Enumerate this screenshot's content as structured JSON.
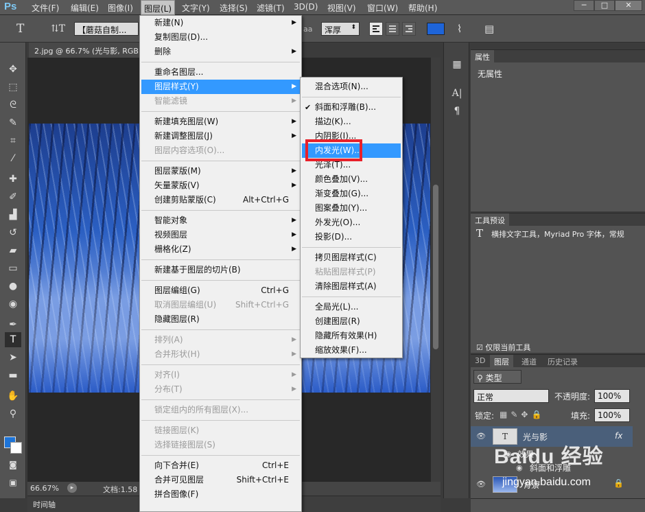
{
  "app": {
    "logo": "Ps"
  },
  "menubar": {
    "items": [
      "文件(F)",
      "编辑(E)",
      "图像(I)",
      "图层(L)",
      "文字(Y)",
      "选择(S)",
      "滤镜(T)",
      "3D(D)",
      "视图(V)",
      "窗口(W)",
      "帮助(H)"
    ],
    "active_index": 3
  },
  "window_controls": {
    "minimize": "─",
    "maximize": "□",
    "close": "✕"
  },
  "options_bar": {
    "tool_glyph": "T",
    "font_family": "【蘑菇自制...",
    "antialias": "浑厚",
    "aa_label": "aa",
    "text_color": "#1e64d8"
  },
  "document": {
    "tab_title": "2.jpg @ 66.7% (光与影, RGB",
    "zoom": "66.67%",
    "doc_info": "文档:1.58",
    "timeline_label": "时间轴"
  },
  "layer_menu": {
    "items": [
      {
        "label": "新建(N)",
        "submenu": true
      },
      {
        "label": "复制图层(D)..."
      },
      {
        "label": "删除",
        "submenu": true
      },
      {
        "sep": true
      },
      {
        "label": "重命名图层..."
      },
      {
        "label": "图层样式(Y)",
        "submenu": true,
        "highlight": true
      },
      {
        "label": "智能滤镜",
        "submenu": true,
        "disabled": true
      },
      {
        "sep": true
      },
      {
        "label": "新建填充图层(W)",
        "submenu": true
      },
      {
        "label": "新建调整图层(J)",
        "submenu": true
      },
      {
        "label": "图层内容选项(O)...",
        "disabled": true
      },
      {
        "sep": true
      },
      {
        "label": "图层蒙版(M)",
        "submenu": true
      },
      {
        "label": "矢量蒙版(V)",
        "submenu": true
      },
      {
        "label": "创建剪贴蒙版(C)",
        "shortcut": "Alt+Ctrl+G"
      },
      {
        "sep": true
      },
      {
        "label": "智能对象",
        "submenu": true
      },
      {
        "label": "视频图层",
        "submenu": true
      },
      {
        "label": "栅格化(Z)",
        "submenu": true
      },
      {
        "sep": true
      },
      {
        "label": "新建基于图层的切片(B)"
      },
      {
        "sep": true
      },
      {
        "label": "图层编组(G)",
        "shortcut": "Ctrl+G"
      },
      {
        "label": "取消图层编组(U)",
        "shortcut": "Shift+Ctrl+G",
        "disabled": true
      },
      {
        "label": "隐藏图层(R)"
      },
      {
        "sep": true
      },
      {
        "label": "排列(A)",
        "submenu": true,
        "disabled": true
      },
      {
        "label": "合并形状(H)",
        "submenu": true,
        "disabled": true
      },
      {
        "sep": true
      },
      {
        "label": "对齐(I)",
        "submenu": true,
        "disabled": true
      },
      {
        "label": "分布(T)",
        "submenu": true,
        "disabled": true
      },
      {
        "sep": true
      },
      {
        "label": "锁定组内的所有图层(X)...",
        "disabled": true
      },
      {
        "sep": true
      },
      {
        "label": "链接图层(K)",
        "disabled": true
      },
      {
        "label": "选择链接图层(S)",
        "disabled": true
      },
      {
        "sep": true
      },
      {
        "label": "向下合并(E)",
        "shortcut": "Ctrl+E"
      },
      {
        "label": "合并可见图层",
        "shortcut": "Shift+Ctrl+E"
      },
      {
        "label": "拼合图像(F)"
      }
    ]
  },
  "style_submenu": {
    "items": [
      {
        "label": "混合选项(N)..."
      },
      {
        "sep": true
      },
      {
        "label": "斜面和浮雕(B)...",
        "checked": true
      },
      {
        "label": "描边(K)..."
      },
      {
        "label": "内阴影(I)..."
      },
      {
        "label": "内发光(W)...",
        "highlight": true
      },
      {
        "label": "光泽(T)..."
      },
      {
        "label": "颜色叠加(V)..."
      },
      {
        "label": "渐变叠加(G)..."
      },
      {
        "label": "图案叠加(Y)..."
      },
      {
        "label": "外发光(O)..."
      },
      {
        "label": "投影(D)..."
      },
      {
        "sep": true
      },
      {
        "label": "拷贝图层样式(C)"
      },
      {
        "label": "粘贴图层样式(P)",
        "disabled": true
      },
      {
        "label": "清除图层样式(A)"
      },
      {
        "sep": true
      },
      {
        "label": "全局光(L)..."
      },
      {
        "label": "创建图层(R)"
      },
      {
        "label": "隐藏所有效果(H)"
      },
      {
        "label": "缩放效果(F)..."
      }
    ]
  },
  "properties_panel": {
    "tab": "属性",
    "content": "无属性"
  },
  "tool_presets_panel": {
    "tab": "工具预设",
    "preset": "横排文字工具，Myriad Pro 字体，常规",
    "current_only": "仅限当前工具"
  },
  "layers_panel": {
    "tabs": [
      "3D",
      "图层",
      "通道",
      "历史记录"
    ],
    "active_tab": 1,
    "filter_kind": "类型",
    "blend_mode": "正常",
    "opacity_label": "不透明度:",
    "opacity_value": "100%",
    "lock_label": "锁定:",
    "fill_label": "填充:",
    "fill_value": "100%",
    "layers": [
      {
        "name": "光与影",
        "type": "text",
        "fx": "fx"
      },
      {
        "name": "效果",
        "sub": true
      },
      {
        "name": "斜面和浮雕",
        "sub": true
      },
      {
        "name": "背景",
        "locked": true
      }
    ]
  },
  "watermark": {
    "logo": "Baidu 经验",
    "url": "jingyan.baidu.com"
  }
}
